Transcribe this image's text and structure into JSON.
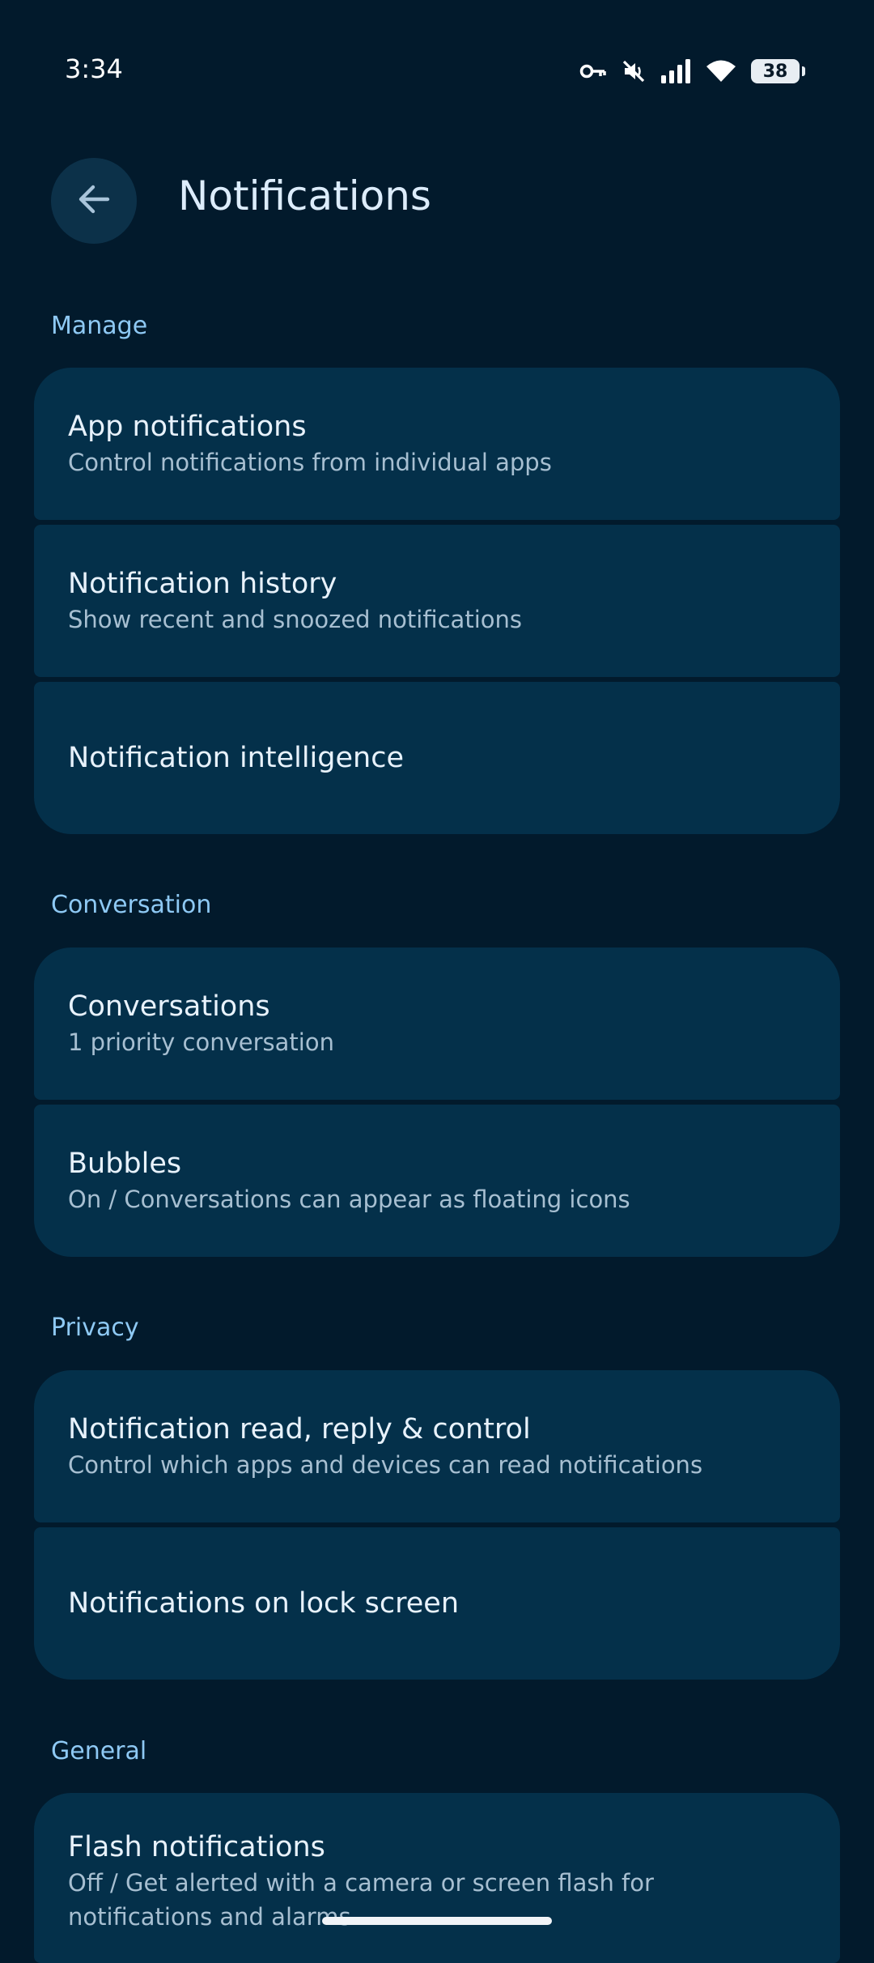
{
  "status_bar": {
    "time": "3:34",
    "battery": "38",
    "icons": [
      "vpn-key-icon",
      "muted-icon",
      "signal-icon",
      "wifi-icon",
      "battery-icon"
    ]
  },
  "header": {
    "title": "Notifications",
    "back_icon": "arrow-back-icon"
  },
  "sections": {
    "manage": {
      "label": "Manage",
      "items": [
        {
          "title": "App notifications",
          "subtitle": "Control notifications from individual apps"
        },
        {
          "title": "Notification history",
          "subtitle": "Show recent and snoozed notifications"
        },
        {
          "title": "Notification intelligence"
        }
      ]
    },
    "conversation": {
      "label": "Conversation",
      "items": [
        {
          "title": "Conversations",
          "subtitle": "1 priority conversation"
        },
        {
          "title": "Bubbles",
          "subtitle": "On / Conversations can appear as floating icons"
        }
      ]
    },
    "privacy": {
      "label": "Privacy",
      "items": [
        {
          "title": "Notification read, reply & control",
          "subtitle": "Control which apps and devices can read notifications"
        },
        {
          "title": "Notifications on lock screen"
        }
      ]
    },
    "general": {
      "label": "General",
      "items": [
        {
          "title": "Flash notifications",
          "subtitle": "Off / Get alerted with a camera or screen flash for notifications and alarms"
        }
      ]
    }
  },
  "colors": {
    "background": "#021a2c",
    "card": "#04304a",
    "accent": "#8ec9f4"
  }
}
